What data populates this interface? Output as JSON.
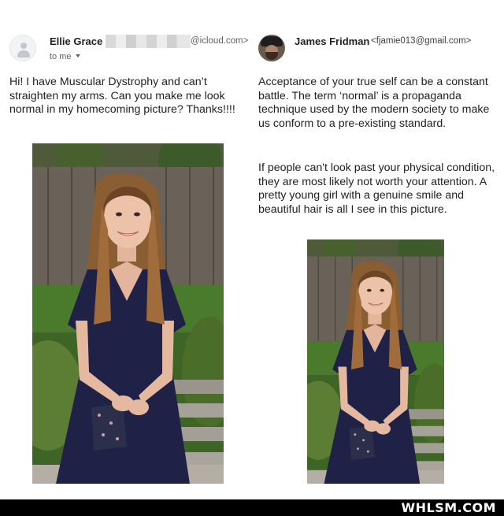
{
  "left_email": {
    "sender_name": "Ellie Grace",
    "sender_domain": "@icloud.com>",
    "to_label": "to me",
    "body": "Hi! I have Muscular Dystrophy and can’t straighten my arms. Can you make me look normal in my homecoming picture? Thanks!!!!"
  },
  "right_email": {
    "sender_name": "James Fridman",
    "sender_address": "<fjamie013@gmail.com>",
    "paragraph_1": "Acceptance of your true self can be a constant battle. The term ‘normal’ is a propaganda technique used by the modern society to make us conform to a pre-existing standard.",
    "paragraph_2": "If people can't look past your physical condition, they are most likely not worth your attention. A pretty young girl with a genuine smile and beautiful hair is all I see in this picture."
  },
  "footer": {
    "brand": "WHLSM.COM"
  },
  "colors": {
    "footer_bg": "#000000",
    "dress": "#1f2246",
    "fence": "#5c534a"
  }
}
